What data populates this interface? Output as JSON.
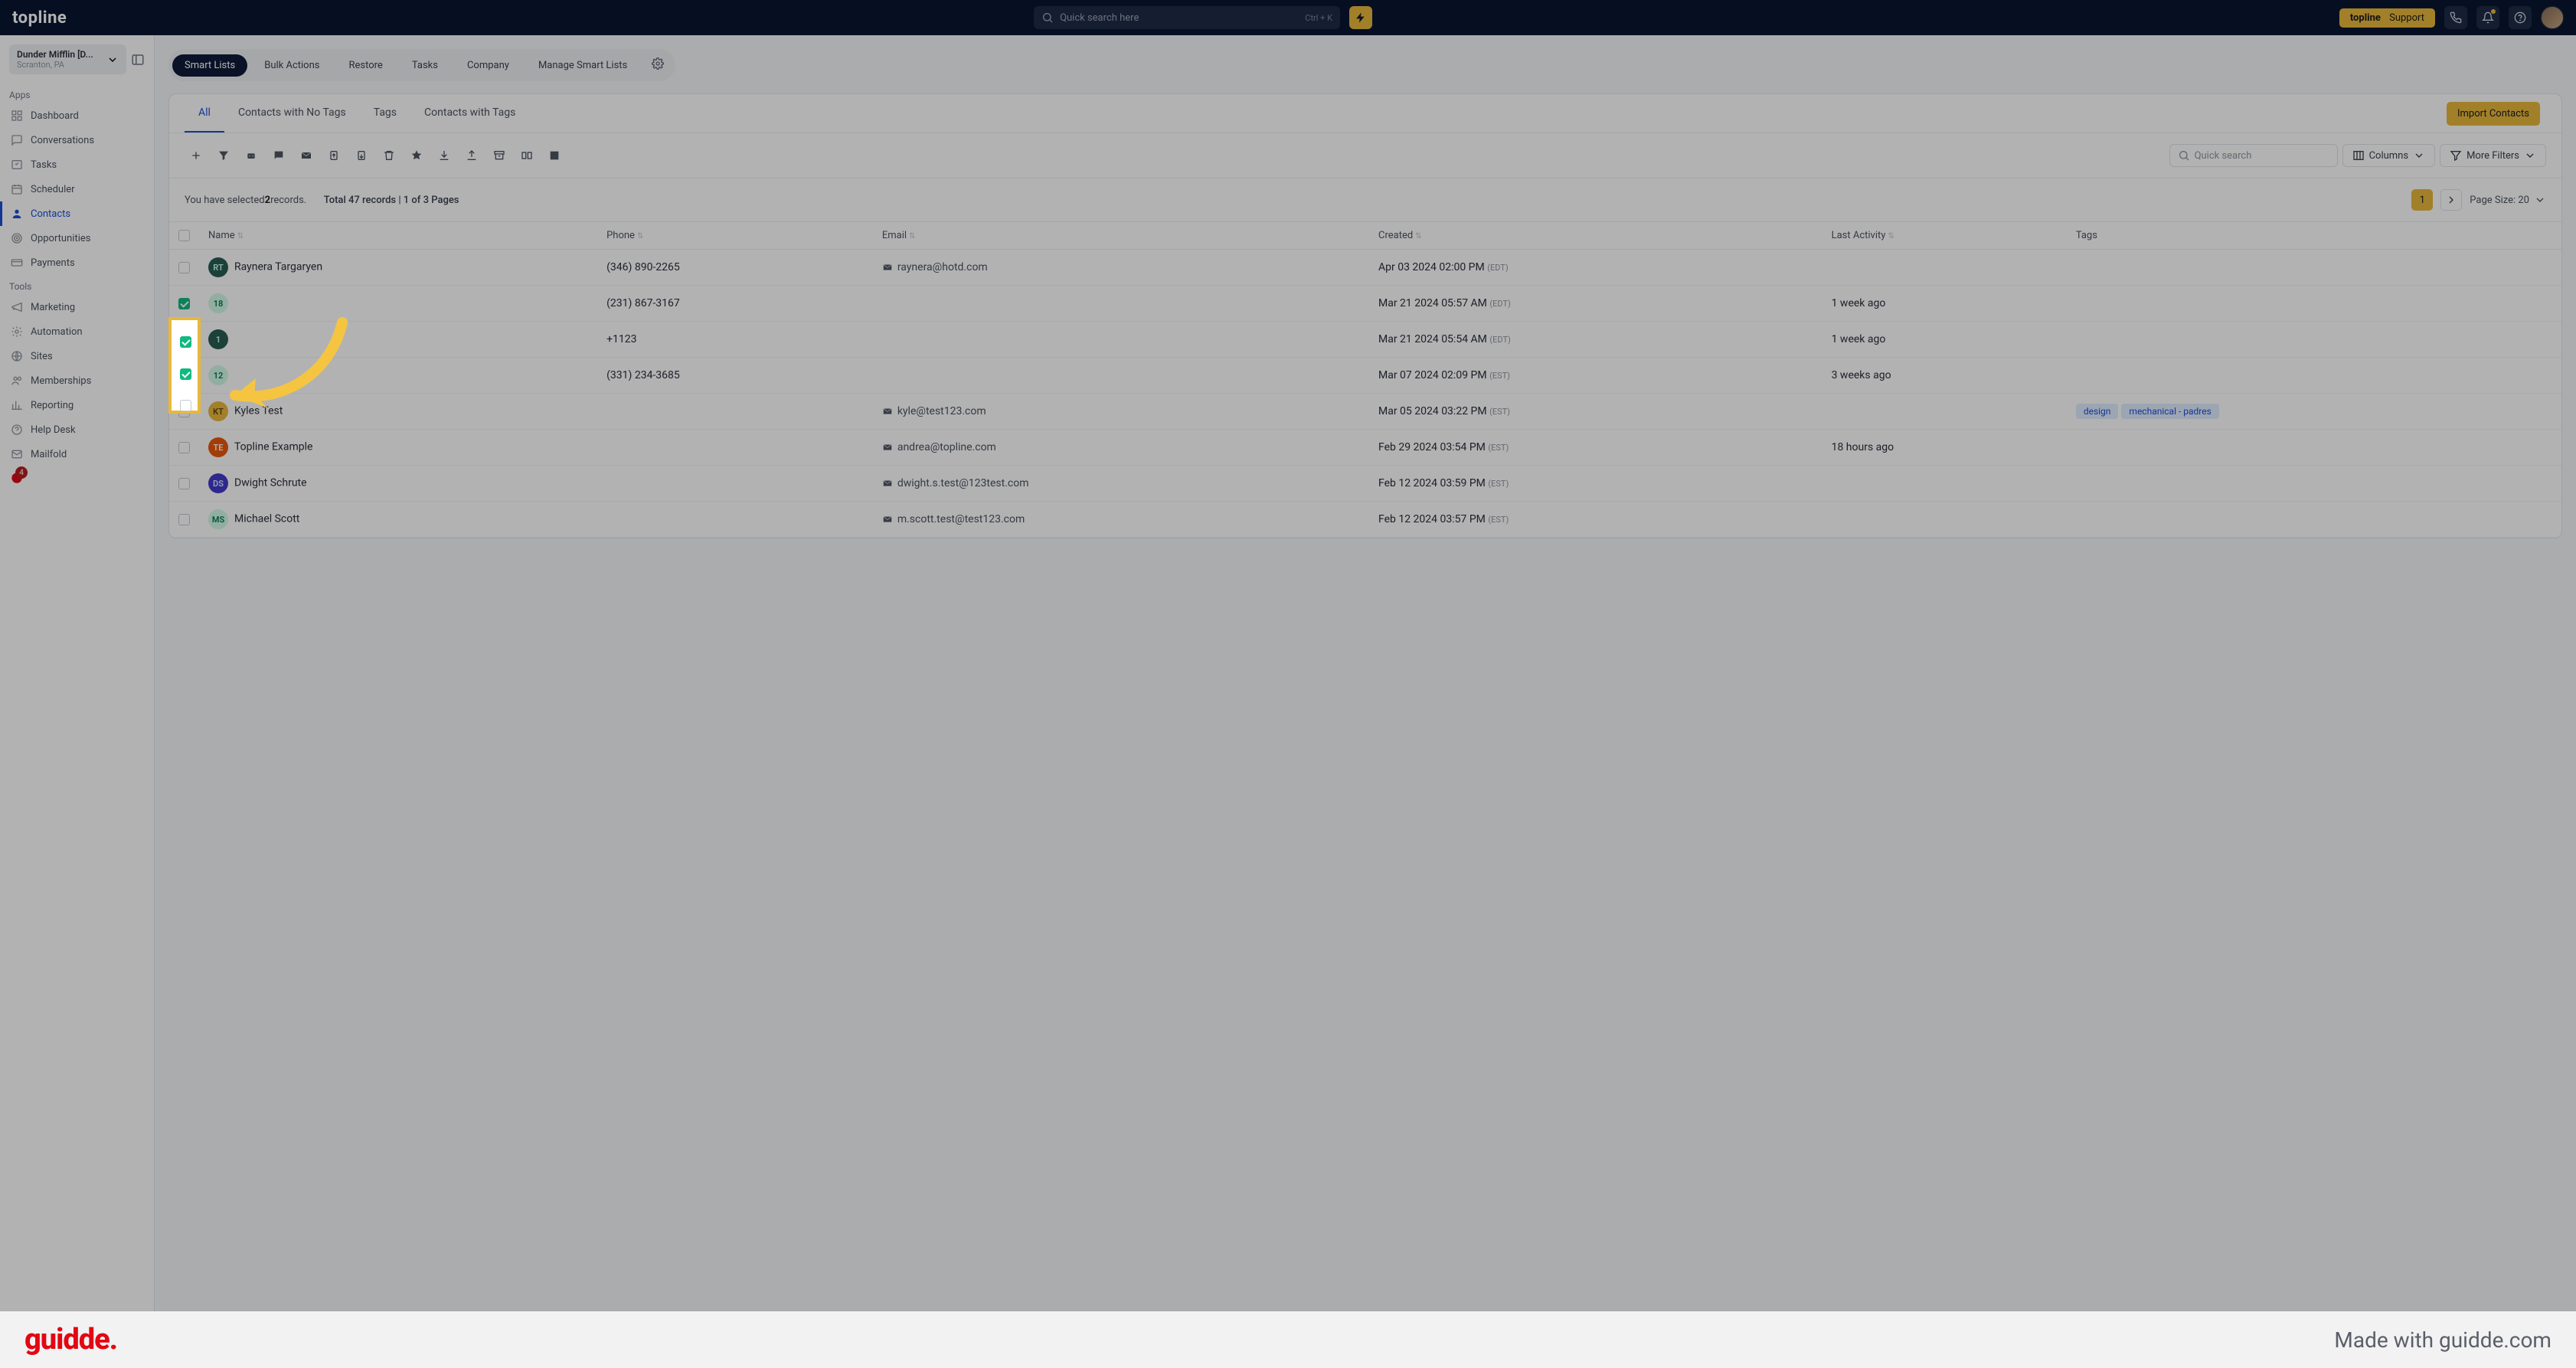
{
  "header": {
    "logo": "topline",
    "search_placeholder": "Quick search here",
    "search_shortcut": "Ctrl + K",
    "support_label": "topline Support"
  },
  "workspace": {
    "name": "Dunder Mifflin [D...",
    "location": "Scranton, PA"
  },
  "sidebar": {
    "apps_label": "Apps",
    "tools_label": "Tools",
    "apps": [
      {
        "label": "Dashboard"
      },
      {
        "label": "Conversations"
      },
      {
        "label": "Tasks"
      },
      {
        "label": "Scheduler"
      },
      {
        "label": "Contacts"
      },
      {
        "label": "Opportunities"
      },
      {
        "label": "Payments"
      }
    ],
    "tools": [
      {
        "label": "Marketing"
      },
      {
        "label": "Automation"
      },
      {
        "label": "Sites"
      },
      {
        "label": "Memberships"
      },
      {
        "label": "Reporting"
      },
      {
        "label": "Help Desk"
      },
      {
        "label": "Mailfold"
      }
    ],
    "badge_count": "4"
  },
  "nav_tabs": [
    "Smart Lists",
    "Bulk Actions",
    "Restore",
    "Tasks",
    "Company",
    "Manage Smart Lists"
  ],
  "sub_tabs": [
    "All",
    "Contacts with No Tags",
    "Tags",
    "Contacts with Tags"
  ],
  "import_label": "Import Contacts",
  "toolbar": {
    "quick_search": "Quick search",
    "columns": "Columns",
    "more_filters": "More Filters"
  },
  "selection": {
    "prefix": "You have selected ",
    "count": "2",
    "suffix": " records.",
    "total_label": "Total 47 records",
    "pages_label": "1 of 3 Pages",
    "page_num": "1",
    "page_size_label": "Page Size: 20"
  },
  "columns": {
    "name": "Name",
    "phone": "Phone",
    "email": "Email",
    "created": "Created",
    "activity": "Last Activity",
    "tags": "Tags"
  },
  "rows": [
    {
      "checked": false,
      "avatar": "RT",
      "av_color": "teal",
      "name": "Raynera Targaryen",
      "phone": "(346) 890-2265",
      "email": "raynera@hotd.com",
      "created": "Apr 03 2024 02:00 PM",
      "tz": "(EDT)",
      "activity": "",
      "tags": []
    },
    {
      "checked": true,
      "avatar": "18",
      "av_color": "green",
      "name": "",
      "phone": "(231) 867-3167",
      "email": "",
      "created": "Mar 21 2024 05:57 AM",
      "tz": "(EDT)",
      "activity": "1 week ago",
      "tags": []
    },
    {
      "checked": true,
      "avatar": "1",
      "av_color": "teal",
      "name": "",
      "phone": "+1123",
      "email": "",
      "created": "Mar 21 2024 05:54 AM",
      "tz": "(EDT)",
      "activity": "1 week ago",
      "tags": []
    },
    {
      "checked": false,
      "avatar": "12",
      "av_color": "green",
      "name": "",
      "phone": "(331) 234-3685",
      "email": "",
      "created": "Mar 07 2024 02:09 PM",
      "tz": "(EST)",
      "activity": "3 weeks ago",
      "tags": []
    },
    {
      "checked": false,
      "avatar": "KT",
      "av_color": "yellow",
      "name": "Kyles Test",
      "phone": "",
      "email": "kyle@test123.com",
      "created": "Mar 05 2024 03:22 PM",
      "tz": "(EST)",
      "activity": "",
      "tags": [
        "design",
        "mechanical - padres"
      ]
    },
    {
      "checked": false,
      "avatar": "TE",
      "av_color": "orange",
      "name": "Topline Example",
      "phone": "",
      "email": "andrea@topline.com",
      "created": "Feb 29 2024 03:54 PM",
      "tz": "(EST)",
      "activity": "18 hours ago",
      "tags": []
    },
    {
      "checked": false,
      "avatar": "DS",
      "av_color": "purple",
      "name": "Dwight Schrute",
      "phone": "",
      "email": "dwight.s.test@123test.com",
      "created": "Feb 12 2024 03:59 PM",
      "tz": "(EST)",
      "activity": "",
      "tags": []
    },
    {
      "checked": false,
      "avatar": "MS",
      "av_color": "green",
      "name": "Michael Scott",
      "phone": "",
      "email": "m.scott.test@test123.com",
      "created": "Feb 12 2024 03:57 PM",
      "tz": "(EST)",
      "activity": "",
      "tags": []
    }
  ],
  "footer": {
    "logo": "guidde.",
    "made_with": "Made with guidde.com"
  }
}
